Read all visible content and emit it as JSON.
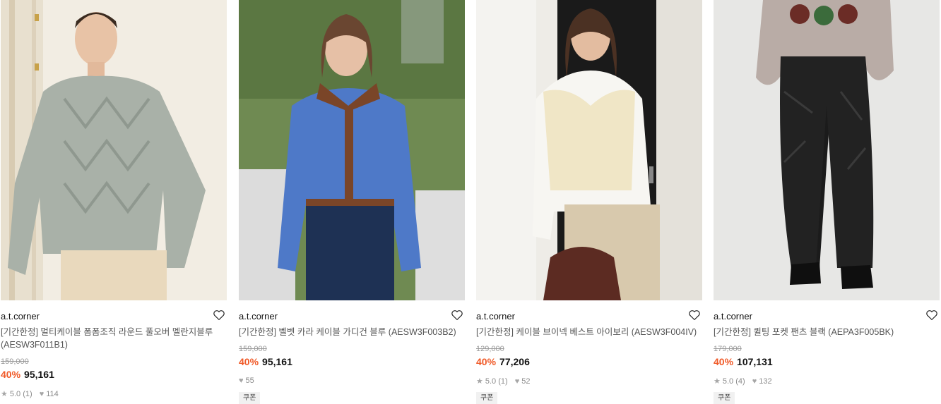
{
  "products": [
    {
      "brand": "a.t.corner",
      "name": "[기간한정] 멀티케이블 폼폼조직 라운드 풀오버 멜란지블루 (AESW3F011B1)",
      "original_price": "159,000",
      "discount": "40%",
      "price": "95,161",
      "rating": "5.0",
      "review_count": "(1)",
      "likes": "114",
      "coupon": ""
    },
    {
      "brand": "a.t.corner",
      "name": "[기간한정] 벨벳 카라 케이블 가디건 블루 (AESW3F003B2)",
      "original_price": "159,000",
      "discount": "40%",
      "price": "95,161",
      "rating": "",
      "review_count": "",
      "likes": "55",
      "coupon": "쿠폰"
    },
    {
      "brand": "a.t.corner",
      "name": "[기간한정] 케이블 브이넥 베스트 아이보리 (AESW3F004IV)",
      "original_price": "129,000",
      "discount": "40%",
      "price": "77,206",
      "rating": "5.0",
      "review_count": "(1)",
      "likes": "52",
      "coupon": "쿠폰"
    },
    {
      "brand": "a.t.corner",
      "name": "[기간한정] 퀼팅 포켓 팬츠 블랙 (AEPA3F005BK)",
      "original_price": "179,000",
      "discount": "40%",
      "price": "107,131",
      "rating": "5.0",
      "review_count": "(4)",
      "likes": "132",
      "coupon": "쿠폰"
    }
  ],
  "icons": {
    "wishlist": "heart-outline-icon",
    "star": "star-icon",
    "likes": "heart-filled-icon"
  },
  "colors": {
    "discount": "#f05a28",
    "muted": "#8a8a8a",
    "coupon_bg": "#f1f1f1"
  }
}
